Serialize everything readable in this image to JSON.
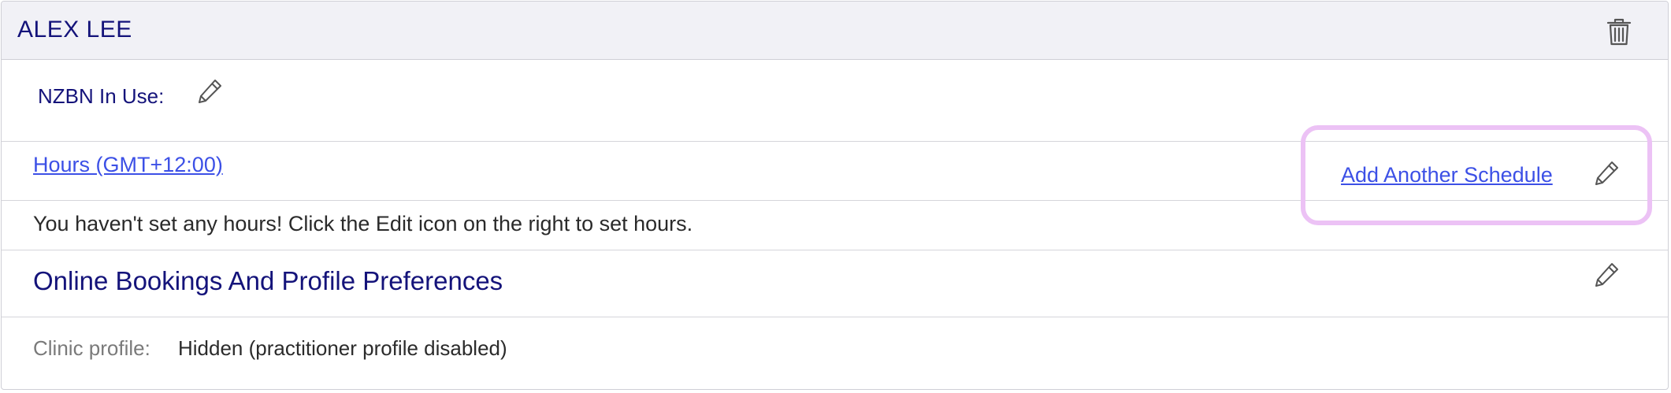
{
  "header": {
    "title": "ALEX LEE",
    "delete_icon": "trash-icon"
  },
  "nzbn": {
    "label": "NZBN In Use:",
    "edit_icon": "pencil-icon"
  },
  "hours": {
    "link_label": "Hours (GMT+12:00)",
    "add_schedule_label": "Add Another Schedule",
    "edit_icon": "pencil-icon",
    "empty_message": "You haven't set any hours! Click the Edit icon on the right to set hours."
  },
  "online_bookings": {
    "title": "Online Bookings And Profile Preferences",
    "edit_icon": "pencil-icon",
    "clinic_profile_label": "Clinic profile:",
    "clinic_profile_value": "Hidden (practitioner profile disabled)"
  },
  "colors": {
    "heading": "#14137a",
    "link": "#3c50e6",
    "header_bg": "#f1f1f6",
    "highlight": "#ecc2f5"
  }
}
